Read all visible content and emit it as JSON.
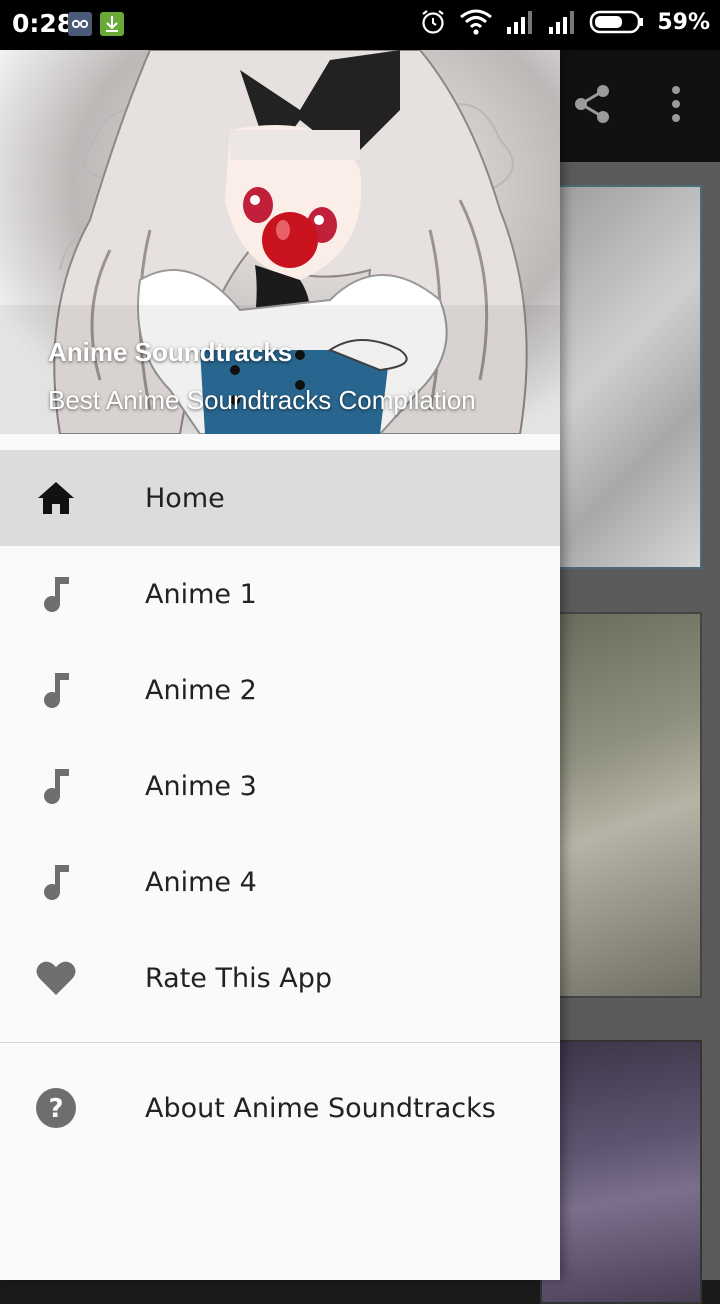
{
  "status_bar": {
    "time": "0:28",
    "battery_percent": "59%",
    "icons": [
      "notification-app-icon",
      "download-icon",
      "alarm-icon",
      "wifi-icon",
      "signal-icon",
      "signal-icon",
      "battery-icon"
    ]
  },
  "app": {
    "toolbar_icons": [
      "share-icon",
      "more-vert-icon"
    ]
  },
  "drawer": {
    "header": {
      "title": "Anime Soundtracks",
      "subtitle": "Best Anime Soundtracks Compilation"
    },
    "menu": [
      {
        "label": "Home",
        "icon": "home-icon",
        "active": true
      },
      {
        "label": "Anime 1",
        "icon": "music-note-icon"
      },
      {
        "label": "Anime 2",
        "icon": "music-note-icon"
      },
      {
        "label": "Anime 3",
        "icon": "music-note-icon"
      },
      {
        "label": "Anime 4",
        "icon": "music-note-icon"
      },
      {
        "label": "Rate This App",
        "icon": "heart-icon"
      }
    ],
    "secondary": [
      {
        "label": "About Anime Soundtracks",
        "icon": "help-icon"
      }
    ]
  },
  "colors": {
    "drawer_bg": "#fafafa",
    "active_item_bg": "#dcdcdc",
    "icon_gray": "#6e6e6e",
    "toolbar_bg": "#111111"
  }
}
